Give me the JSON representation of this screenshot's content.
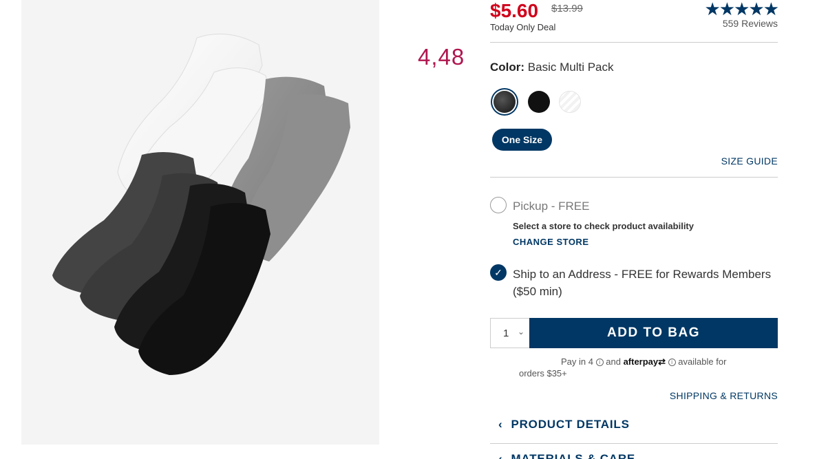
{
  "product_image": {
    "alt": "socks"
  },
  "converted_price": "4,48",
  "price": {
    "current": "$5.60",
    "original": "$13.99",
    "deal_label": "Today Only Deal"
  },
  "rating": {
    "stars": "★★★★★",
    "reviews": "559 Reviews"
  },
  "color": {
    "label": "Color:",
    "value": "Basic Multi Pack"
  },
  "size": {
    "selected": "One Size",
    "guide_link": "SIZE GUIDE"
  },
  "fulfillment": {
    "pickup_label": "Pickup - FREE",
    "store_message": "Select a store to check product availability",
    "change_store": "CHANGE STORE",
    "ship_label": "Ship to an Address - FREE for Rewards Members ($50 min)"
  },
  "cart": {
    "quantity": "1",
    "add_button": "ADD TO BAG"
  },
  "afterpay": {
    "pre": "Pay in 4",
    "and": "and",
    "brand": "afterpay",
    "post": "available for orders $35+"
  },
  "links": {
    "shipping_returns": "SHIPPING & RETURNS"
  },
  "accordion": {
    "product_details": "PRODUCT DETAILS",
    "materials": "MATERIALS & CARE"
  },
  "colors": {
    "brand_navy": "#003764",
    "sale_red": "#d0021b",
    "converted_price": "#b0164f"
  }
}
